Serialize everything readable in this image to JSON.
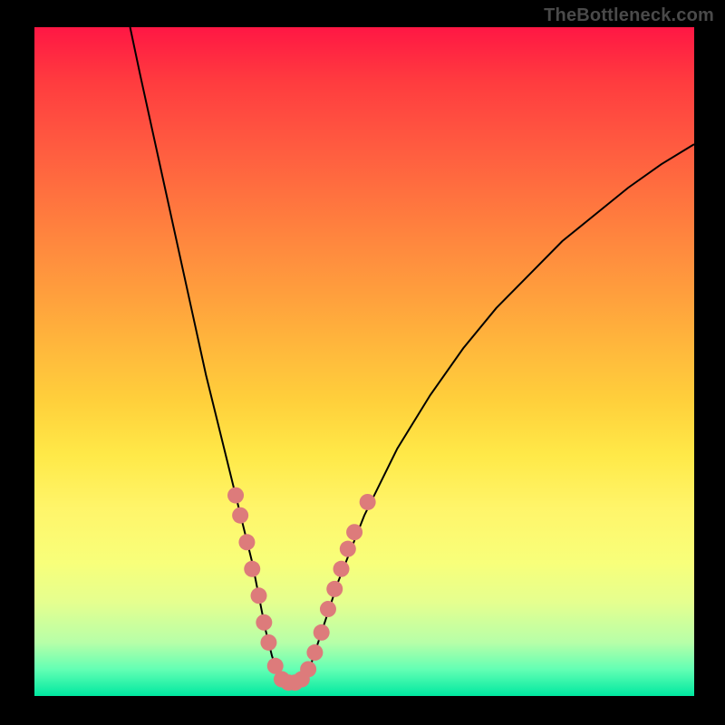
{
  "watermark": "TheBottleneck.com",
  "chart_data": {
    "type": "line",
    "title": "",
    "xlabel": "",
    "ylabel": "",
    "xlim": [
      0,
      100
    ],
    "ylim": [
      0,
      100
    ],
    "curve": {
      "description": "V-shaped curve with apex near x≈38, steep descending left arm and shallower ascending right arm",
      "points": [
        {
          "x": 14.5,
          "y": 100
        },
        {
          "x": 16,
          "y": 93
        },
        {
          "x": 18,
          "y": 84
        },
        {
          "x": 20,
          "y": 75
        },
        {
          "x": 22,
          "y": 66
        },
        {
          "x": 24,
          "y": 57
        },
        {
          "x": 26,
          "y": 48
        },
        {
          "x": 28,
          "y": 40
        },
        {
          "x": 30,
          "y": 32
        },
        {
          "x": 31,
          "y": 28
        },
        {
          "x": 32,
          "y": 24
        },
        {
          "x": 33,
          "y": 20
        },
        {
          "x": 34,
          "y": 15
        },
        {
          "x": 35,
          "y": 10
        },
        {
          "x": 36,
          "y": 6
        },
        {
          "x": 37,
          "y": 3
        },
        {
          "x": 38,
          "y": 2
        },
        {
          "x": 39,
          "y": 2
        },
        {
          "x": 40,
          "y": 2
        },
        {
          "x": 41,
          "y": 3
        },
        {
          "x": 42,
          "y": 5
        },
        {
          "x": 43,
          "y": 8
        },
        {
          "x": 44,
          "y": 11
        },
        {
          "x": 46,
          "y": 17
        },
        {
          "x": 48,
          "y": 22
        },
        {
          "x": 50,
          "y": 27
        },
        {
          "x": 55,
          "y": 37
        },
        {
          "x": 60,
          "y": 45
        },
        {
          "x": 65,
          "y": 52
        },
        {
          "x": 70,
          "y": 58
        },
        {
          "x": 75,
          "y": 63
        },
        {
          "x": 80,
          "y": 68
        },
        {
          "x": 85,
          "y": 72
        },
        {
          "x": 90,
          "y": 76
        },
        {
          "x": 95,
          "y": 79.5
        },
        {
          "x": 100,
          "y": 82.5
        }
      ]
    },
    "markers": {
      "color": "#dd7b7b",
      "radius": 9,
      "points": [
        {
          "x": 30.5,
          "y": 30
        },
        {
          "x": 31.2,
          "y": 27
        },
        {
          "x": 32.2,
          "y": 23
        },
        {
          "x": 33.0,
          "y": 19
        },
        {
          "x": 34.0,
          "y": 15
        },
        {
          "x": 34.8,
          "y": 11
        },
        {
          "x": 35.5,
          "y": 8
        },
        {
          "x": 36.5,
          "y": 4.5
        },
        {
          "x": 37.5,
          "y": 2.5
        },
        {
          "x": 38.5,
          "y": 2
        },
        {
          "x": 39.5,
          "y": 2
        },
        {
          "x": 40.5,
          "y": 2.5
        },
        {
          "x": 41.5,
          "y": 4
        },
        {
          "x": 42.5,
          "y": 6.5
        },
        {
          "x": 43.5,
          "y": 9.5
        },
        {
          "x": 44.5,
          "y": 13
        },
        {
          "x": 45.5,
          "y": 16
        },
        {
          "x": 46.5,
          "y": 19
        },
        {
          "x": 47.5,
          "y": 22
        },
        {
          "x": 48.5,
          "y": 24.5
        },
        {
          "x": 50.5,
          "y": 29
        }
      ]
    }
  }
}
